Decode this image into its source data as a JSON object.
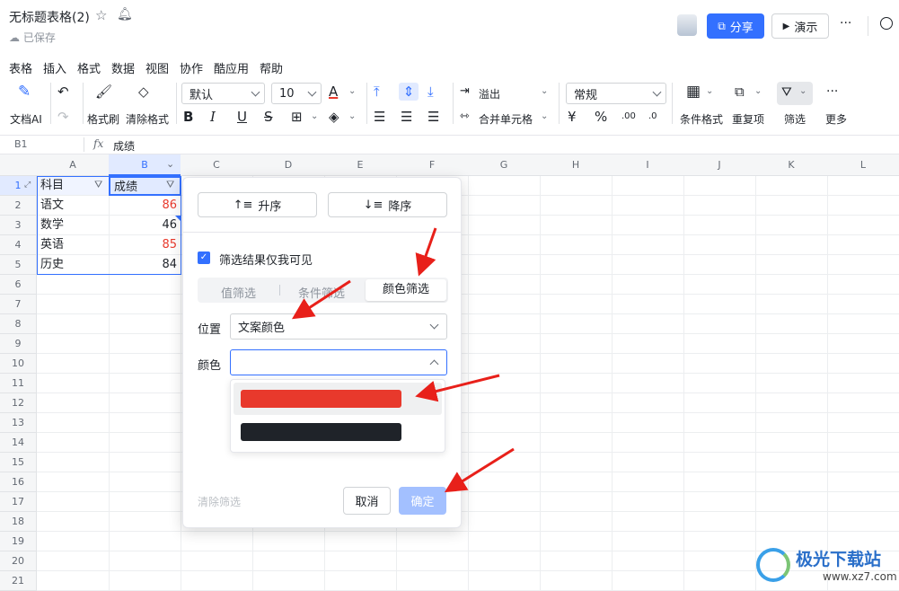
{
  "doc": {
    "title": "无标题表格(2)",
    "saved": "已保存"
  },
  "header": {
    "share": "分享",
    "present": "演示",
    "more": "···"
  },
  "menu": [
    "表格",
    "插入",
    "格式",
    "数据",
    "视图",
    "协作",
    "酷应用",
    "帮助"
  ],
  "toolbar": {
    "doc_ai": "文档AI",
    "format_brush": "格式刷",
    "clear_format": "清除格式",
    "font_name": "默认",
    "font_size": "10",
    "overflow": "溢出",
    "merge": "合并单元格",
    "number_format": "常规",
    "currency": "¥",
    "percent": "%",
    "cond_format": "条件格式",
    "duplicates": "重复项",
    "filter": "筛选",
    "more": "更多",
    "accent": "#3370ff"
  },
  "formula": {
    "cell_ref": "B1",
    "fx": "fx",
    "value": "成绩"
  },
  "columns": [
    "A",
    "B",
    "C",
    "D",
    "E",
    "F",
    "G",
    "H",
    "I",
    "J",
    "K",
    "L"
  ],
  "rows": [
    "1",
    "2",
    "3",
    "4",
    "5",
    "6",
    "7",
    "8",
    "9",
    "10",
    "11",
    "12",
    "13",
    "14",
    "15",
    "16",
    "17",
    "18",
    "19",
    "20",
    "21"
  ],
  "table": {
    "headers": [
      "科目",
      "成绩"
    ],
    "data": [
      {
        "subject": "语文",
        "score": "86",
        "color": "#e8392c"
      },
      {
        "subject": "数学",
        "score": "46",
        "color": "#1f2329"
      },
      {
        "subject": "英语",
        "score": "85",
        "color": "#e8392c"
      },
      {
        "subject": "历史",
        "score": "84",
        "color": "#1f2329"
      }
    ]
  },
  "filter_panel": {
    "sort_asc": "升序",
    "sort_desc": "降序",
    "only_me": "筛选结果仅我可见",
    "tabs": [
      "值筛选",
      "条件筛选",
      "颜色筛选"
    ],
    "position_label": "位置",
    "position_value": "文案颜色",
    "color_label": "颜色",
    "color_options": [
      "#e8392c",
      "#1f2329"
    ],
    "clear": "清除筛选",
    "cancel": "取消",
    "confirm": "确定"
  },
  "watermark": {
    "brand": "极光下载站",
    "url": "www.xz7.com"
  }
}
